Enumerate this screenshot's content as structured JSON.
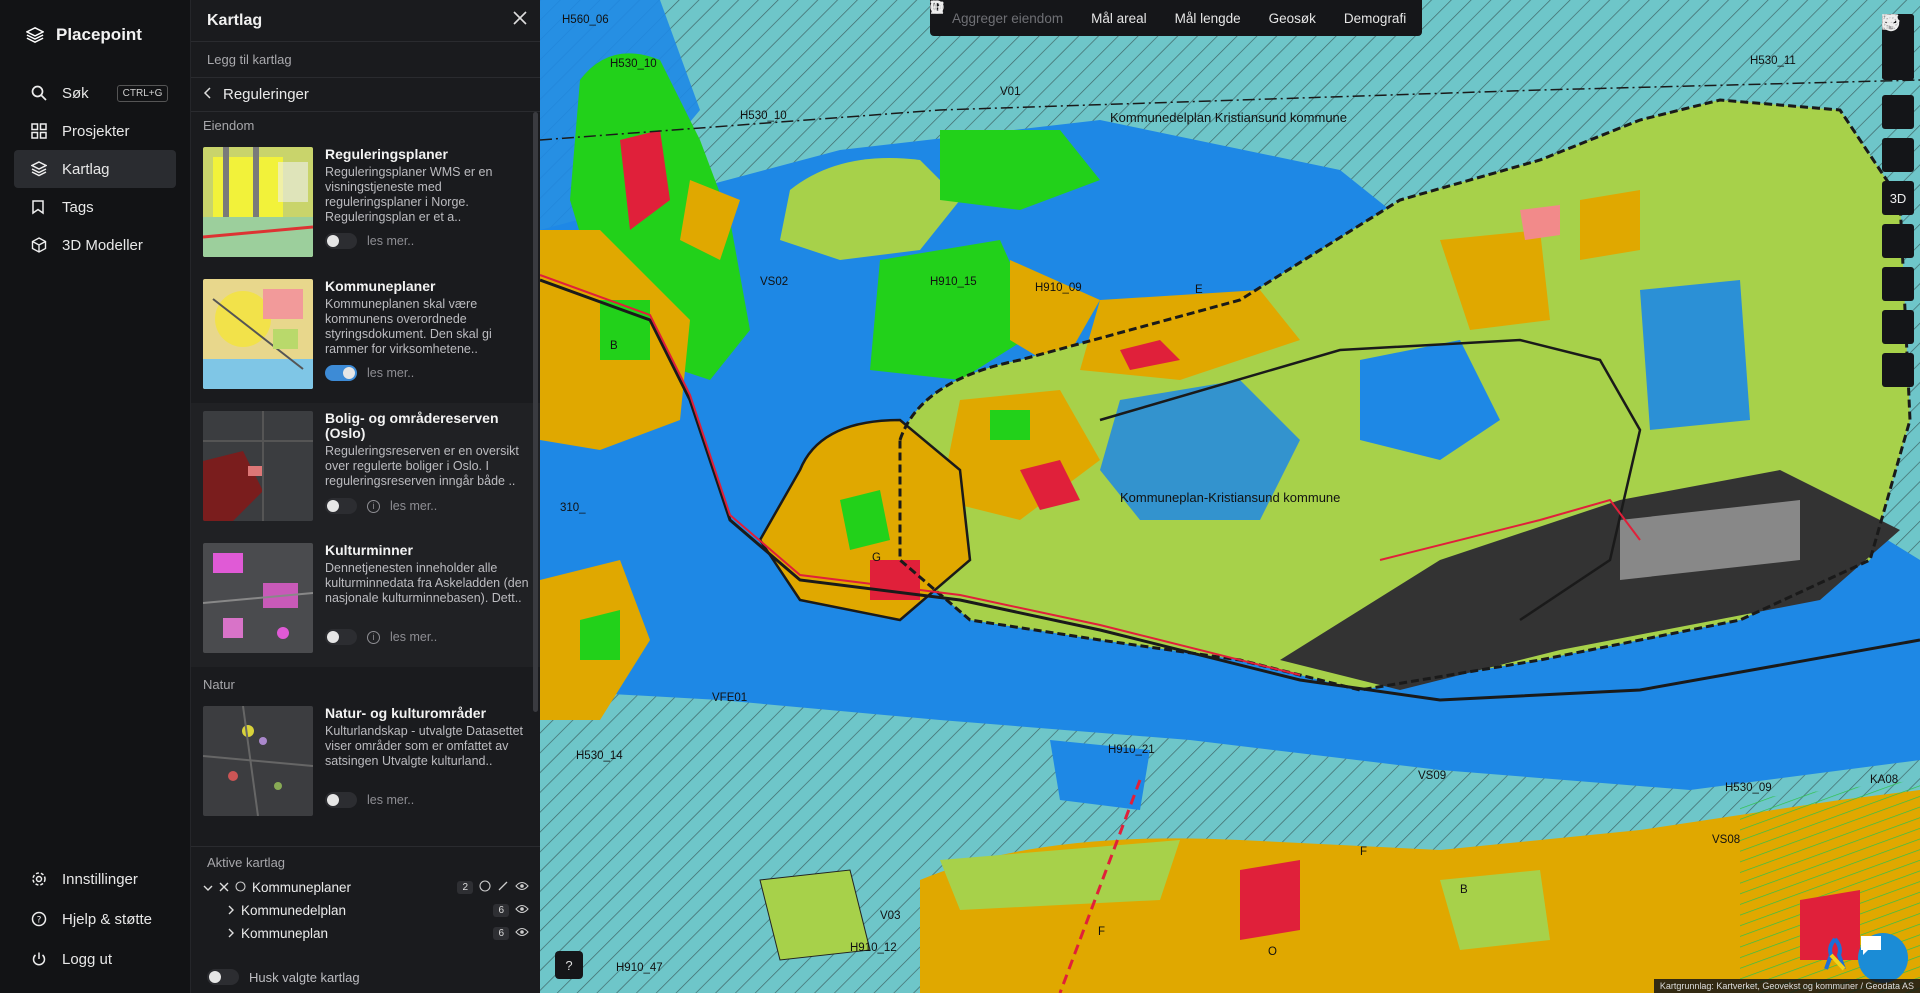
{
  "app": {
    "name": "Placepoint"
  },
  "nav": {
    "items": [
      {
        "label": "Søk",
        "shortcut": "CTRL+G"
      },
      {
        "label": "Prosjekter"
      },
      {
        "label": "Kartlag"
      },
      {
        "label": "Tags"
      },
      {
        "label": "3D Modeller"
      }
    ],
    "bottom": [
      {
        "label": "Innstillinger"
      },
      {
        "label": "Hjelp & støtte"
      },
      {
        "label": "Logg ut"
      }
    ]
  },
  "panel": {
    "title": "Kartlag",
    "add_layer": "Legg til kartlag",
    "breadcrumb": "Reguleringer",
    "sections": [
      {
        "label": "Eiendom",
        "layers": [
          {
            "title": "Reguleringsplaner",
            "desc": "Reguleringsplaner WMS er en visningstjeneste med reguleringsplaner i Norge. Reguleringsplan er et a..",
            "toggle": false,
            "more": "les mer.."
          },
          {
            "title": "Kommuneplaner",
            "desc": "Kommuneplanen skal være kommunens overordnede styringsdokument. Den skal gi rammer for virksomhetene..",
            "toggle": true,
            "more": "les mer.."
          },
          {
            "title": "Bolig- og områdereserven (Oslo)",
            "desc": "Reguleringsreserven er en oversikt over regulerte boliger i Oslo. I reguleringsreserven inngår både ..",
            "toggle": false,
            "more": "les mer.."
          },
          {
            "title": "Kulturminner",
            "desc": "Dennetjenesten inneholder alle kulturminnedata fra Askeladden (den nasjonale kulturminnebasen). Dett..",
            "toggle": false,
            "more": "les mer.."
          }
        ]
      },
      {
        "label": "Natur",
        "layers": [
          {
            "title": "Natur- og kulturområder",
            "desc": "Kulturlandskap - utvalgte Datasettet viser områder som er omfattet av satsingen Utvalgte kulturland..",
            "toggle": false,
            "more": "les mer.."
          }
        ]
      }
    ],
    "active": {
      "title": "Aktive kartlag",
      "group": {
        "label": "Kommuneplaner",
        "count": "2"
      },
      "children": [
        {
          "label": "Kommunedelplan",
          "count": "6"
        },
        {
          "label": "Kommuneplan",
          "count": "6"
        }
      ],
      "remember": "Husk valgte kartlag"
    }
  },
  "toolbar": {
    "items": [
      {
        "label": "Aggreger eiendom",
        "enabled": false
      },
      {
        "label": "Mål areal",
        "enabled": true
      },
      {
        "label": "Mål lengde",
        "enabled": true
      },
      {
        "label": "Geosøk",
        "enabled": true
      },
      {
        "label": "Demografi",
        "enabled": true
      }
    ]
  },
  "map_tools": {
    "mode_3d": "3D"
  },
  "map_labels": [
    "H560_06",
    "H530_10",
    "H530_10",
    "V01",
    "Kommunedelplan Kristiansund kommune",
    "H530_11",
    "Kommuneplan-Kristiansund kommune",
    "VS02",
    "H910_15",
    "H910_09",
    "E",
    "B",
    "G",
    "310_",
    "VFE01",
    "H530_14",
    "H910_21",
    "VS09",
    "KA08",
    "H530_09",
    "VS08",
    "V03",
    "H910_12",
    "H910_47",
    "F",
    "B",
    "F",
    "O"
  ],
  "attribution": "Kartgrunnlag: Kartverket, Geovekst og kommuner / Geodata AS",
  "colors": {
    "water": "#1e88e5",
    "sea": "#6ec6c9",
    "residential": "#e0a800",
    "green": "#22d11a",
    "agri": "#a7d14a",
    "panel": "#1a1b1e",
    "accent": "#3d8bd6"
  }
}
